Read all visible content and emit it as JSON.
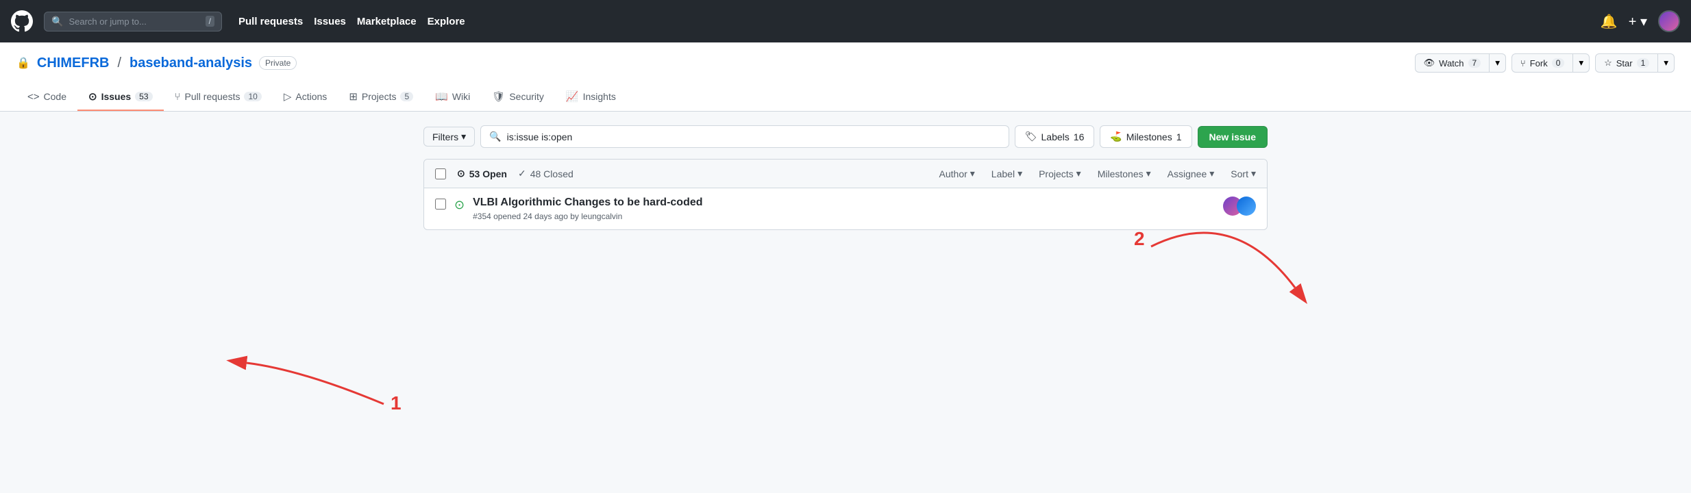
{
  "nav": {
    "search_placeholder": "Search or jump to...",
    "slash_key": "/",
    "links": [
      "Pull requests",
      "Issues",
      "Marketplace",
      "Explore"
    ],
    "notification_icon": "🔔",
    "add_icon": "+"
  },
  "repo": {
    "owner": "CHIMEFRB",
    "name": "baseband-analysis",
    "visibility": "Private",
    "watch_label": "Watch",
    "watch_count": "7",
    "fork_label": "Fork",
    "fork_count": "0",
    "star_label": "Star",
    "star_count": "1"
  },
  "tabs": [
    {
      "id": "code",
      "label": "Code",
      "icon": "<>",
      "count": null,
      "active": false
    },
    {
      "id": "issues",
      "label": "Issues",
      "icon": "⊙",
      "count": "53",
      "active": true
    },
    {
      "id": "pull-requests",
      "label": "Pull requests",
      "icon": "⎇",
      "count": "10",
      "active": false
    },
    {
      "id": "actions",
      "label": "Actions",
      "icon": "▷",
      "count": null,
      "active": false
    },
    {
      "id": "projects",
      "label": "Projects",
      "icon": "⊞",
      "count": "5",
      "active": false
    },
    {
      "id": "wiki",
      "label": "Wiki",
      "icon": "📖",
      "count": null,
      "active": false
    },
    {
      "id": "security",
      "label": "Security",
      "icon": "🛡",
      "count": null,
      "active": false
    },
    {
      "id": "insights",
      "label": "Insights",
      "icon": "📈",
      "count": null,
      "active": false
    }
  ],
  "issues": {
    "filters_label": "Filters",
    "search_value": "is:issue is:open",
    "labels_label": "Labels",
    "labels_count": "16",
    "milestones_label": "Milestones",
    "milestones_count": "1",
    "new_issue_label": "New issue",
    "open_count": "53 Open",
    "closed_count": "48 Closed",
    "header_filters": [
      "Author",
      "Label",
      "Projects",
      "Milestones",
      "Assignee",
      "Sort"
    ],
    "items": [
      {
        "id": "#354",
        "title": "VLBI Algorithmic Changes to be hard-coded",
        "meta": "#354 opened 24 days ago by leungcalvin"
      }
    ]
  },
  "annotations": {
    "arrow1_label": "1",
    "arrow2_label": "2"
  }
}
